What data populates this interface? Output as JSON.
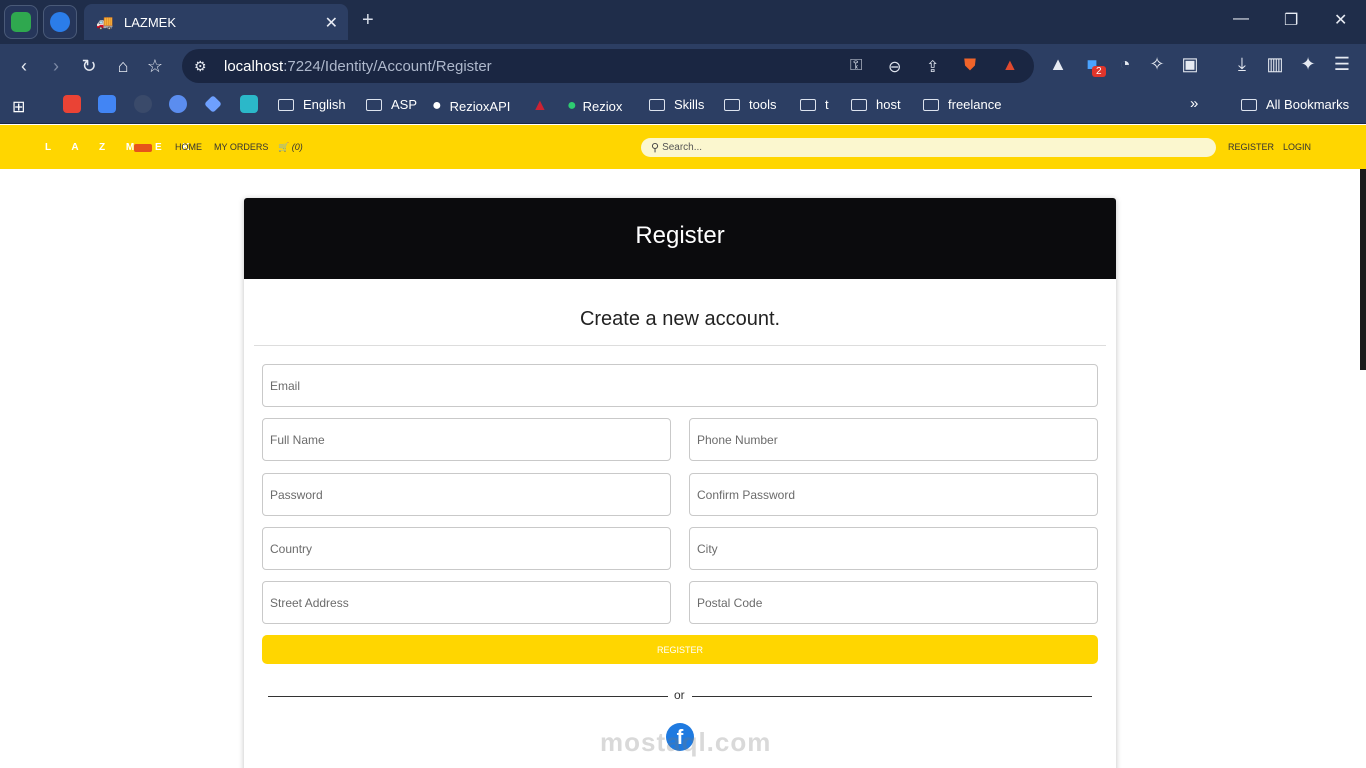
{
  "browser": {
    "tab_title": "LAZMEK",
    "url_host": "localhost",
    "url_rest": ":7224/Identity/Account/Register",
    "bookmarks": [
      "English",
      "ASP",
      "RezioxAPI",
      "Reziox",
      "Skills",
      "tools",
      "t",
      "host",
      "freelance"
    ],
    "all_bookmarks": "All Bookmarks",
    "ext_badge": "2",
    "brave_badge": "1"
  },
  "site": {
    "logo": "L A Z M E K",
    "nav": {
      "home": "HOME",
      "orders": "MY ORDERS",
      "cart_count": "(0)"
    },
    "search_placeholder": "Search...",
    "register_link": "REGISTER",
    "login_link": "LOGIN"
  },
  "form": {
    "title": "Register",
    "subtitle": "Create a new account.",
    "email": "Email",
    "full_name": "Full Name",
    "phone": "Phone Number",
    "password": "Password",
    "confirm_password": "Confirm Password",
    "country": "Country",
    "city": "City",
    "street": "Street Address",
    "postal": "Postal Code",
    "submit": "REGISTER",
    "or": "or"
  },
  "watermark": "mostaql.com",
  "colors": {
    "accent": "#ffd600",
    "header_dark": "#0b0b0d",
    "chrome": "#2c3e63"
  }
}
